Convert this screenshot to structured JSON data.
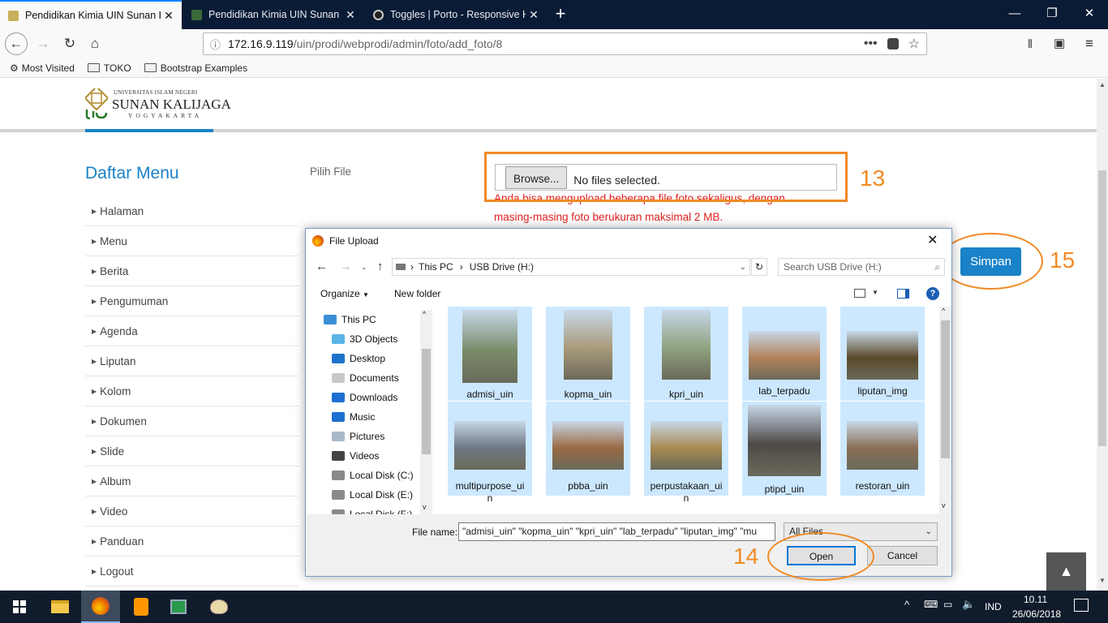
{
  "browser": {
    "tabs": [
      {
        "title": "Pendidikan Kimia UIN Sunan Ka",
        "active": true
      },
      {
        "title": "Pendidikan Kimia UIN Sunan Ka",
        "active": false
      },
      {
        "title": "Toggles | Porto - Responsive H",
        "active": false
      }
    ],
    "url_host": "172.16.9.119",
    "url_path": "/uin/prodi/webprodi/admin/foto/add_foto/8",
    "bookmarks": [
      "Most Visited",
      "TOKO",
      "Bootstrap Examples"
    ]
  },
  "site": {
    "logo_top": "UNIVERSITAS ISLAM NEGERI",
    "logo_name": "SUNAN KALIJAGA",
    "logo_city": "YOGYAKARTA",
    "menu_title": "Daftar Menu",
    "menu_items": [
      "Halaman",
      "Menu",
      "Berita",
      "Pengumuman",
      "Agenda",
      "Liputan",
      "Kolom",
      "Dokumen",
      "Slide",
      "Album",
      "Video",
      "Panduan",
      "Logout"
    ],
    "field_label": "Pilih File",
    "browse_label": "Browse...",
    "file_status": "No files selected.",
    "hint_line1": "Anda bisa mengupload beberapa file foto sekaligus, dengan",
    "hint_line2": "masing-masing foto berukuran maksimal 2 MB.",
    "save_label": "Simpan"
  },
  "annotations": {
    "a13": "13",
    "a14": "14",
    "a15": "15",
    "color": "#f08a24"
  },
  "dialog": {
    "title": "File Upload",
    "breadcrumb": [
      "This PC",
      "USB Drive (H:)"
    ],
    "search_placeholder": "Search USB Drive (H:)",
    "organize": "Organize",
    "new_folder": "New folder",
    "tree": [
      {
        "label": "This PC",
        "icon": "computer-icon"
      },
      {
        "label": "3D Objects",
        "icon": "cube-icon"
      },
      {
        "label": "Desktop",
        "icon": "desktop-icon"
      },
      {
        "label": "Documents",
        "icon": "documents-icon"
      },
      {
        "label": "Downloads",
        "icon": "download-icon"
      },
      {
        "label": "Music",
        "icon": "music-icon"
      },
      {
        "label": "Pictures",
        "icon": "pictures-icon"
      },
      {
        "label": "Videos",
        "icon": "videos-icon"
      },
      {
        "label": "Local Disk (C:)",
        "icon": "drive-icon"
      },
      {
        "label": "Local Disk (E:)",
        "icon": "drive-icon"
      },
      {
        "label": "Local Disk (F:)",
        "icon": "drive-icon"
      }
    ],
    "files": [
      {
        "name": "admisi_uin",
        "name2": "",
        "thumb": "#7a8c6a"
      },
      {
        "name": "kopma_uin",
        "name2": "",
        "thumb": "#a99a7a"
      },
      {
        "name": "kpri_uin",
        "name2": "",
        "thumb": "#8fa27d"
      },
      {
        "name": "lab_terpadu",
        "name2": "",
        "thumb": "#b2825b"
      },
      {
        "name": "liputan_img",
        "name2": "",
        "thumb": "#5a4a2a"
      },
      {
        "name": "multipurpose_ui",
        "name2": "n",
        "thumb": "#6f7783"
      },
      {
        "name": "pbba_uin",
        "name2": "",
        "thumb": "#9a6a45"
      },
      {
        "name": "perpustakaan_ui",
        "name2": "n",
        "thumb": "#a88a52"
      },
      {
        "name": "ptipd_uin",
        "name2": "",
        "thumb": "#4e4a48"
      },
      {
        "name": "restoran_uin",
        "name2": "",
        "thumb": "#8a6f55"
      }
    ],
    "filename_label": "File name:",
    "filename_value": "\"admisi_uin\" \"kopma_uin\" \"kpri_uin\" \"lab_terpadu\" \"liputan_img\" \"mu",
    "filetype": "All Files",
    "open_label": "Open",
    "cancel_label": "Cancel"
  },
  "taskbar": {
    "language": "IND",
    "time": "10.11",
    "date": "26/06/2018"
  }
}
